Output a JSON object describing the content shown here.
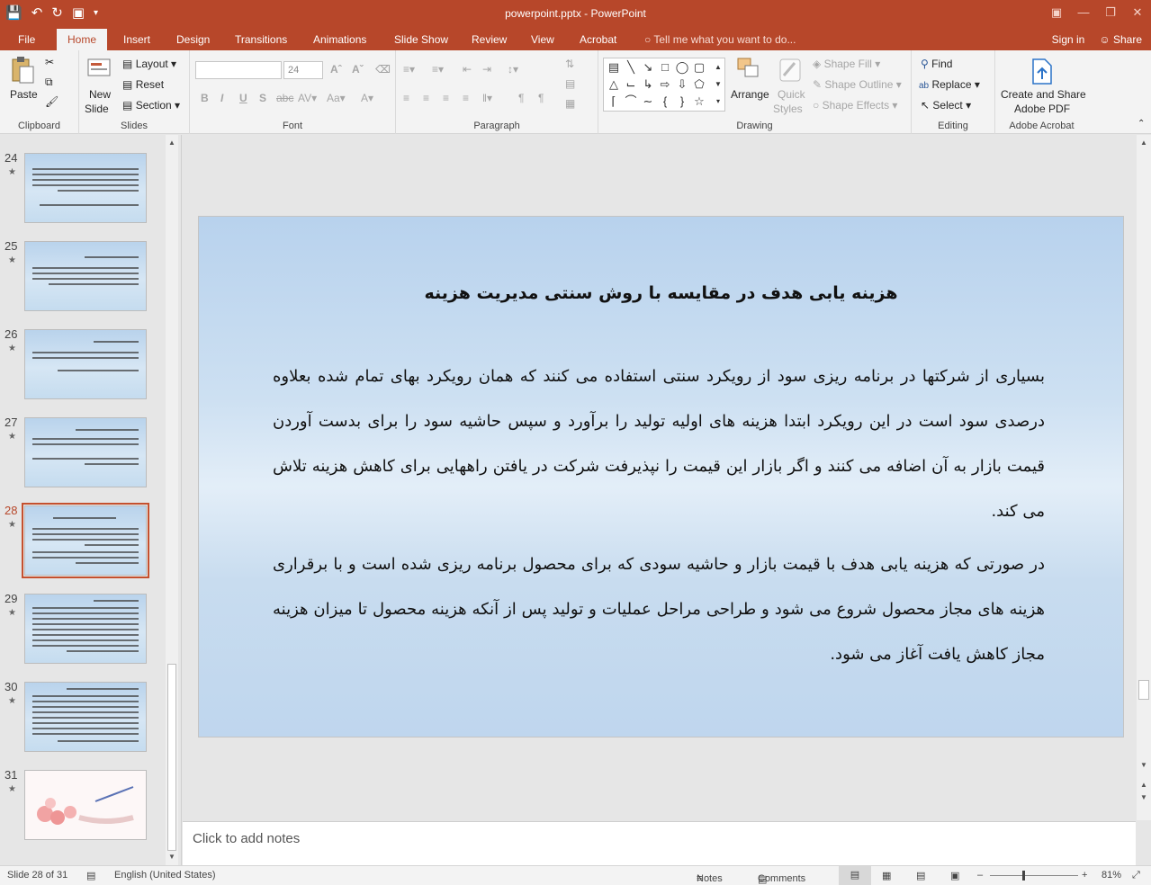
{
  "window": {
    "title": "powerpoint.pptx - PowerPoint"
  },
  "tabs": [
    "File",
    "Home",
    "Insert",
    "Design",
    "Transitions",
    "Animations",
    "Slide Show",
    "Review",
    "View",
    "Acrobat"
  ],
  "tell_me": "Tell me what you want to do...",
  "sign_in": "Sign in",
  "share": "Share",
  "ribbon": {
    "clipboard": {
      "label": "Clipboard",
      "paste": "Paste"
    },
    "slides": {
      "label": "Slides",
      "new_slide_1": "New",
      "new_slide_2": "Slide",
      "layout": "Layout",
      "reset": "Reset",
      "section": "Section"
    },
    "font": {
      "label": "Font",
      "font_name": "",
      "font_size": "24"
    },
    "paragraph": {
      "label": "Paragraph"
    },
    "drawing": {
      "label": "Drawing",
      "arrange": "Arrange",
      "quick_styles_1": "Quick",
      "quick_styles_2": "Styles",
      "shape_fill": "Shape Fill",
      "shape_outline": "Shape Outline",
      "shape_effects": "Shape Effects"
    },
    "editing": {
      "label": "Editing",
      "find": "Find",
      "replace": "Replace",
      "select": "Select"
    },
    "acrobat": {
      "label": "Adobe Acrobat",
      "create_1": "Create and Share",
      "create_2": "Adobe PDF"
    }
  },
  "thumbnails": [
    {
      "num": "24"
    },
    {
      "num": "25"
    },
    {
      "num": "26"
    },
    {
      "num": "27"
    },
    {
      "num": "28"
    },
    {
      "num": "29"
    },
    {
      "num": "30"
    },
    {
      "num": "31"
    }
  ],
  "slide": {
    "title": "هزینه یابی هدف در مقایسه با روش سنتی مدیریت هزینه",
    "para1": "بسیاری از شرکتها در برنامه ریزی سود از رویکرد سنتی استفاده می کنند که همان رویکرد بهای تمام شده بعلاوه درصدی سود است در این رویکرد ابتدا هزینه های اولیه تولید را برآورد و سپس حاشیه سود را برای بدست آوردن قیمت بازار به آن اضافه می کنند و اگر بازار این قیمت را نپذیرفت شرکت در یافتن راههایی برای کاهش هزینه تلاش می کند.",
    "para2": "در صورتی که هزینه یابی هدف با قیمت بازار و حاشیه سودی که برای محصول برنامه ریزی شده است و با برقراری هزینه های مجاز محصول شروع می شود و طراحی مراحل عملیات و تولید پس از آنکه هزینه محصول تا میزان هزینه مجاز کاهش یافت آغاز می شود."
  },
  "notes_placeholder": "Click to add notes",
  "status": {
    "slide_info": "Slide 28 of 31",
    "language": "English (United States)",
    "notes": "Notes",
    "comments": "Comments",
    "zoom": "81%"
  }
}
